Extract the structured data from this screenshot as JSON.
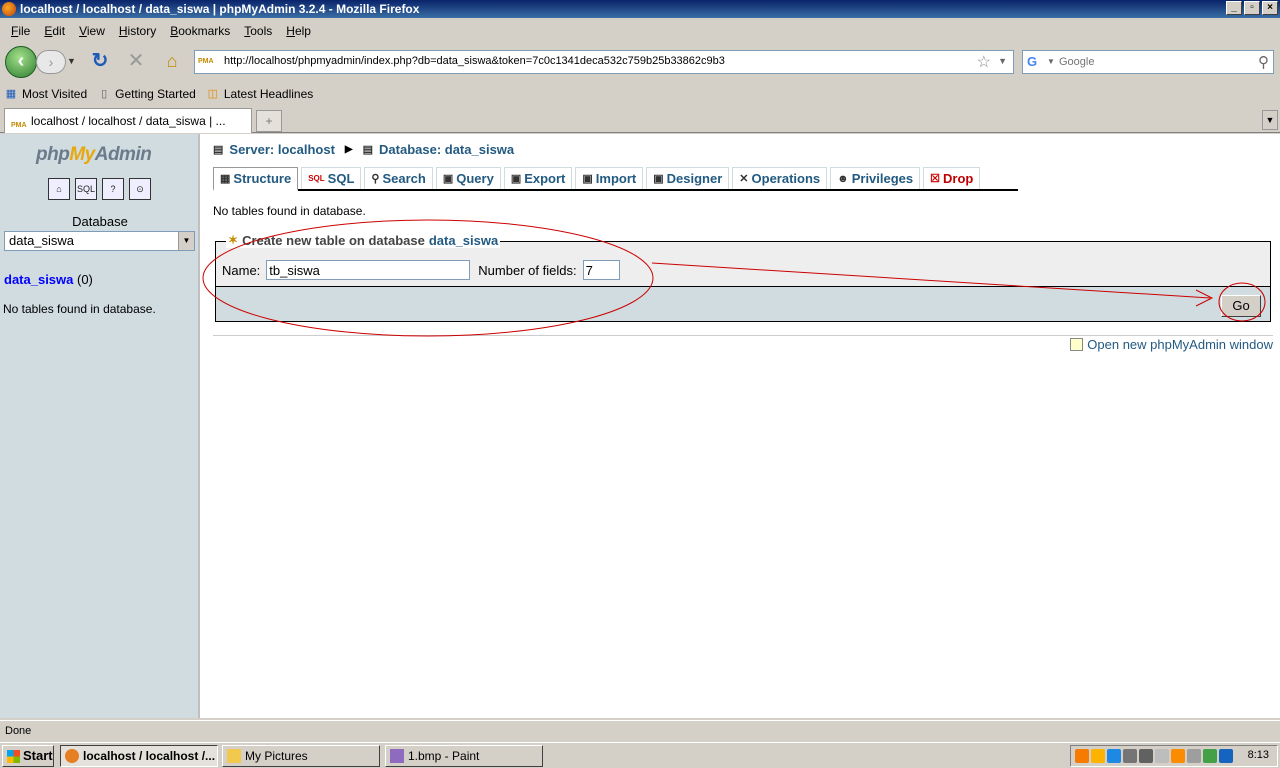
{
  "window": {
    "title": "localhost / localhost / data_siswa | phpMyAdmin 3.2.4 - Mozilla Firefox",
    "controls": [
      "_",
      "▫",
      "×"
    ]
  },
  "menu": [
    "File",
    "Edit",
    "View",
    "History",
    "Bookmarks",
    "Tools",
    "Help"
  ],
  "navbar": {
    "url": "http://localhost/phpmyadmin/index.php?db=data_siswa&token=7c0c1341deca532c759b25b33862c9b3",
    "search_placeholder": "Google",
    "favicon_text": "PMA"
  },
  "bookmarks": [
    "Most Visited",
    "Getting Started",
    "Latest Headlines"
  ],
  "tab": {
    "title": "localhost / localhost / data_siswa | ..."
  },
  "sidebar": {
    "logo_php": "php",
    "logo_my": "My",
    "logo_admin": "Admin",
    "icons": [
      "home-icon",
      "sql-query-icon",
      "documentation-icon",
      "mysql-docs-icon"
    ],
    "database_label": "Database",
    "database_select": "data_siswa",
    "db_link": "data_siswa",
    "db_count": "(0)",
    "no_tables": "No tables found in database."
  },
  "main": {
    "breadcrumb_server": "Server: localhost",
    "breadcrumb_db": "Database: data_siswa",
    "tabs": [
      {
        "label": "Structure",
        "icon": "structure-icon",
        "active": true
      },
      {
        "label": "SQL",
        "icon": "sql-icon"
      },
      {
        "label": "Search",
        "icon": "search-icon"
      },
      {
        "label": "Query",
        "icon": "query-icon"
      },
      {
        "label": "Export",
        "icon": "export-icon"
      },
      {
        "label": "Import",
        "icon": "import-icon"
      },
      {
        "label": "Designer",
        "icon": "designer-icon"
      },
      {
        "label": "Operations",
        "icon": "operations-icon"
      },
      {
        "label": "Privileges",
        "icon": "privileges-icon"
      },
      {
        "label": "Drop",
        "icon": "drop-icon"
      }
    ],
    "notice": "No tables found in database.",
    "create_legend": "Create new table on database",
    "create_db": "data_siswa",
    "name_label": "Name:",
    "name_value": "tb_siswa",
    "fields_label": "Number of fields:",
    "fields_value": "7",
    "go_label": "Go",
    "open_window": "Open new phpMyAdmin window"
  },
  "status": "Done",
  "taskbar": {
    "start": "Start",
    "items": [
      {
        "label": "localhost / localhost /...",
        "active": true
      },
      {
        "label": "My Pictures"
      },
      {
        "label": "1.bmp - Paint"
      }
    ],
    "clock": "8:13"
  },
  "colors": {
    "link": "#235a81",
    "sidebar_bg": "#d0dce0",
    "annotation": "#cc0000"
  }
}
